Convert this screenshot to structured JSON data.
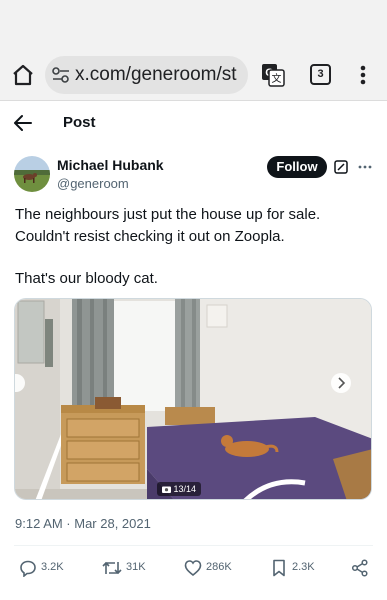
{
  "browser": {
    "url": "x.com/generoom/st",
    "tab_count": "3",
    "icons": {
      "home": "home-icon",
      "site_settings": "tune-icon",
      "translate": "translate-icon",
      "menu": "more-vert-icon"
    }
  },
  "header": {
    "title": "Post"
  },
  "author": {
    "name": "Michael Hubank",
    "handle": "@generoom",
    "follow_label": "Follow"
  },
  "tweet": {
    "line1": "The neighbours just put the house up for sale.",
    "line2": "Couldn't resist checking it out on Zoopla.",
    "line3": "That's our bloody cat."
  },
  "media": {
    "counter": "13/14",
    "description_icon": "camera-icon"
  },
  "meta": {
    "timestamp": "9:12 AM · Mar 28, 2021"
  },
  "actions": {
    "replies": "3.2K",
    "reposts": "31K",
    "likes": "286K",
    "bookmarks": "2.3K"
  },
  "colors": {
    "text": "#0f1419",
    "secondary": "#536471",
    "follow_bg": "#0f1419",
    "browser_bg": "#f2f2f2",
    "url_pill": "#e3e3e3",
    "bedspread": "#5b4a7f"
  }
}
